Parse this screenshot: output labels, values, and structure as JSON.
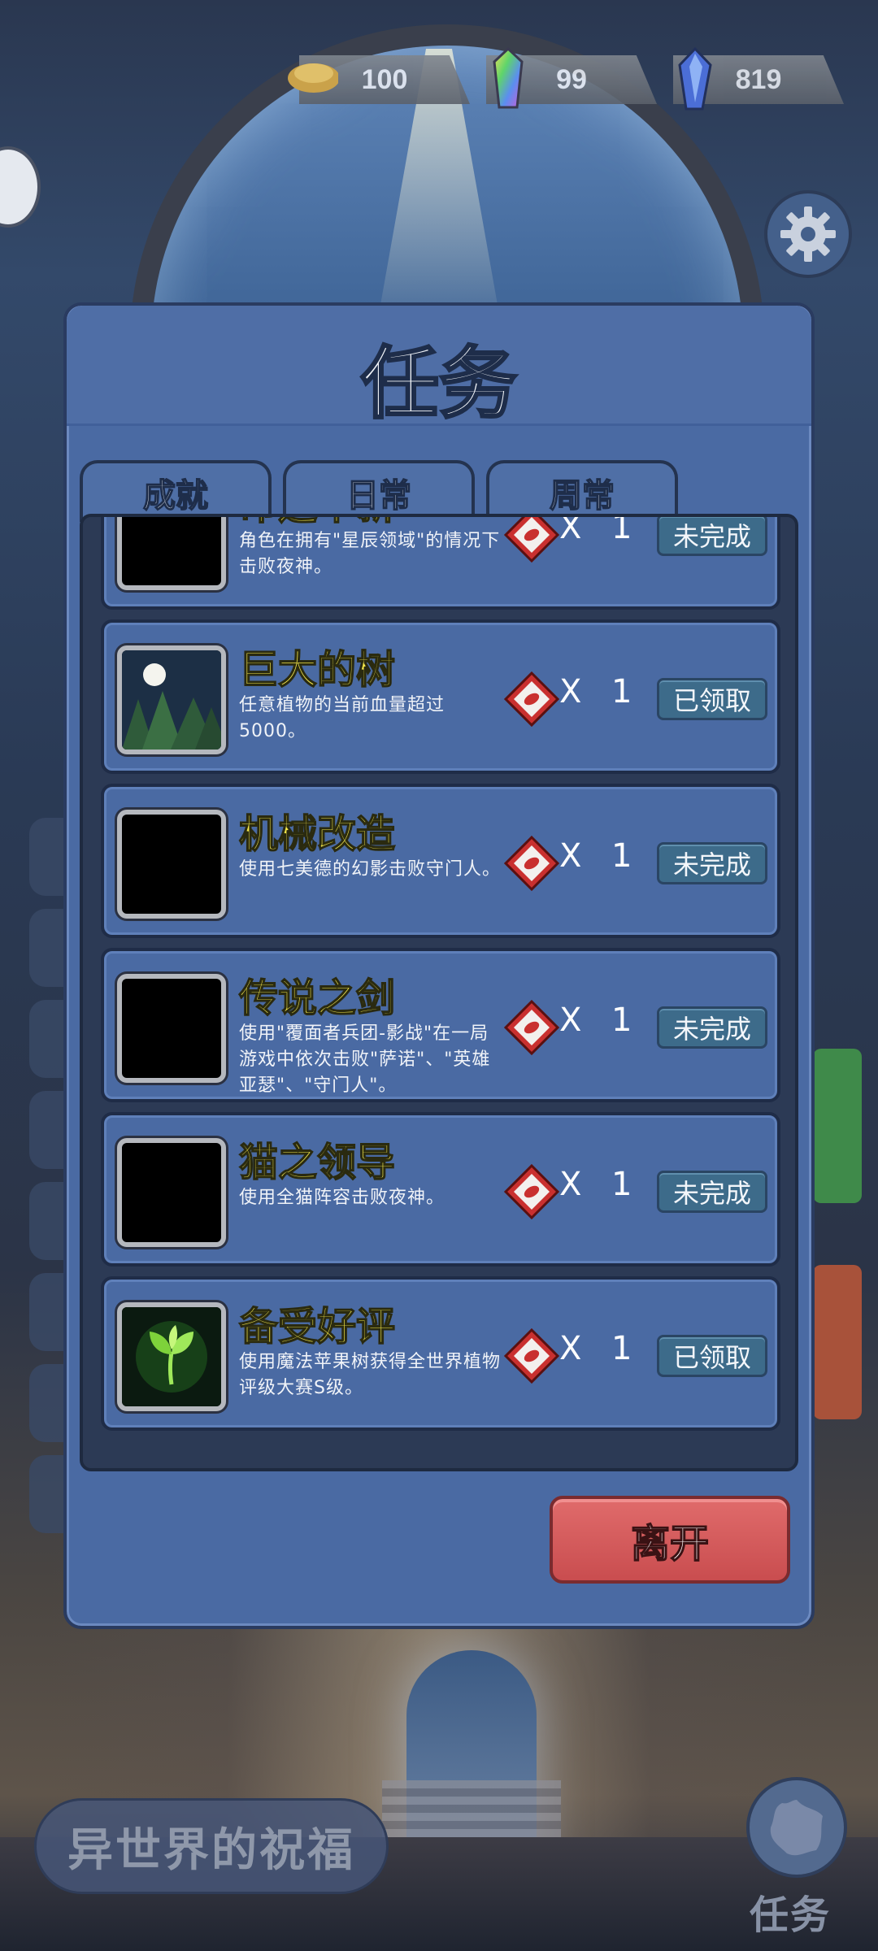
{
  "currencies": [
    {
      "name": "gold",
      "value": "100"
    },
    {
      "name": "rainbow-crystal",
      "value": "99"
    },
    {
      "name": "blue-crystal",
      "value": "819"
    }
  ],
  "panel": {
    "title": "任务",
    "tabs": [
      "成就",
      "日常",
      "周常"
    ],
    "leave_label": "离开"
  },
  "quests": [
    {
      "name": "命运革新",
      "desc": "角色在拥有\"星辰领域\"的情况下击败夜神。",
      "reward_x": "X",
      "reward_count": "1",
      "status": "未完成",
      "thumb": "black"
    },
    {
      "name": "巨大的树",
      "desc": "任意植物的当前血量超过5000。",
      "reward_x": "X",
      "reward_count": "1",
      "status": "已领取",
      "thumb": "night-forest"
    },
    {
      "name": "机械改造",
      "desc": "使用七美德的幻影击败守门人。",
      "reward_x": "X",
      "reward_count": "1",
      "status": "未完成",
      "thumb": "black"
    },
    {
      "name": "传说之剑",
      "desc": "使用\"覆面者兵团-影战\"在一局游戏中依次击败\"萨诺\"、\"英雄亚瑟\"、\"守门人\"。",
      "reward_x": "X",
      "reward_count": "1",
      "status": "未完成",
      "thumb": "black"
    },
    {
      "name": "猫之领导",
      "desc": "使用全猫阵容击败夜神。",
      "reward_x": "X",
      "reward_count": "1",
      "status": "未完成",
      "thumb": "black"
    },
    {
      "name": "备受好评",
      "desc": "使用魔法苹果树获得全世界植物评级大赛S级。",
      "reward_x": "X",
      "reward_count": "1",
      "status": "已领取",
      "thumb": "green-sprout"
    }
  ],
  "bottom": {
    "blessing_label": "异世界的祝福",
    "task_label": "任务"
  },
  "colors": {
    "panel": "#4a6aa3",
    "quest_title": "#f3e64a",
    "leave_button": "#d65c5e",
    "status_button": "#3d6b8a"
  }
}
